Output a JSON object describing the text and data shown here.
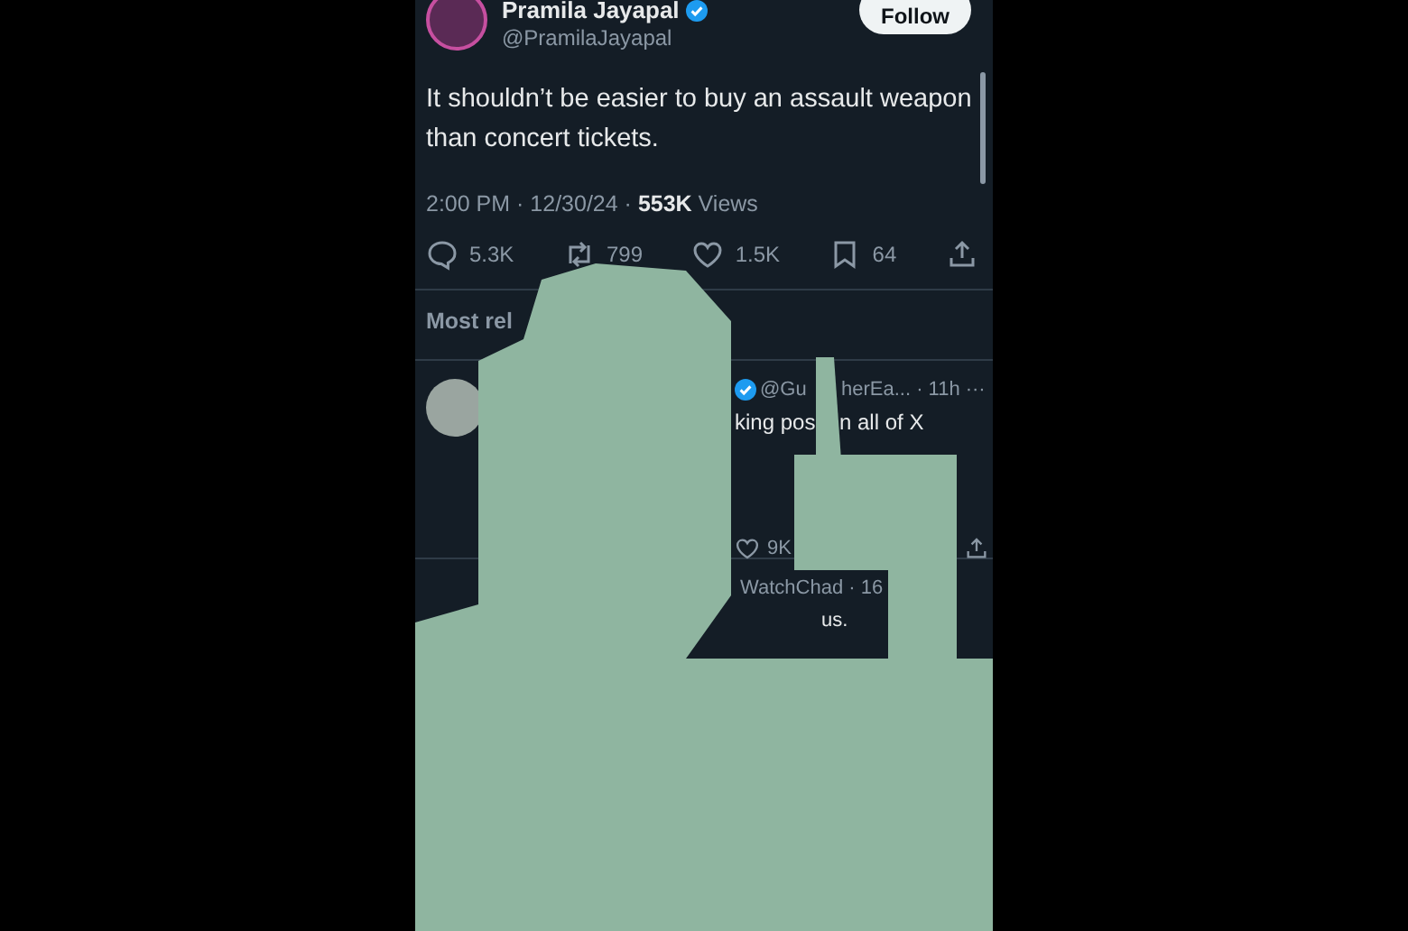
{
  "post": {
    "author": "Pramila Jayapal",
    "handle": "@PramilaJayapal",
    "verified": true,
    "follow_label": "Follow",
    "text": "It shouldn’t be easier to buy an assault weapon than concert tickets.",
    "meta": "2:00 PM · 12/30/24 · **553K** Views",
    "actions": [
      {
        "kind": "reply",
        "count": "5.3K"
      },
      {
        "kind": "repost",
        "count": "799"
      },
      {
        "kind": "like",
        "count": "1.5K"
      },
      {
        "kind": "bookmark",
        "count": "64"
      },
      {
        "kind": "share"
      }
    ]
  },
  "section_label": "Most rel",
  "replies": [
    {
      "verified": true,
      "header_parts": [
        "@Gu",
        "herEa... · 11h"
      ],
      "more": "···",
      "text_parts": [
        "king pos",
        "n all of X"
      ],
      "like_count": "9K"
    },
    {
      "header_parts": [
        "WatchChad · 16"
      ],
      "text_parts": [
        "us."
      ]
    }
  ]
}
